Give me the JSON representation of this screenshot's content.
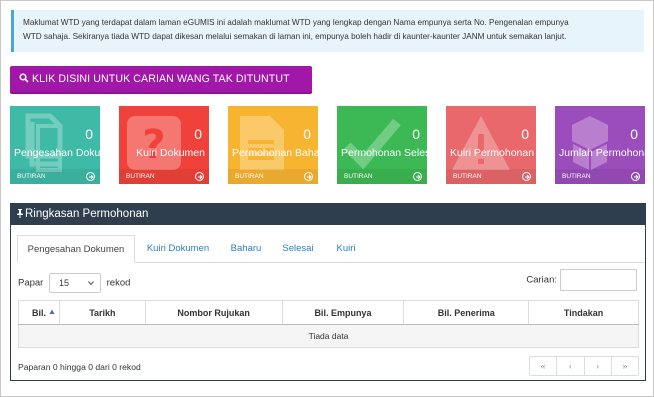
{
  "notice": {
    "line1": "Maklumat WTD yang terdapat dalam laman eGUMIS ini adalah maklumat WTD yang lengkap dengan Nama empunya serta No. Pengenalan empunya",
    "line2": "WTD sahaja. Sekiranya tiada WTD dapat dikesan melalui semakan di laman ini, empunya boleh hadir di kaunter-kaunter JANM untuk semakan lanjut."
  },
  "search_button": {
    "label": "KLIK DISINI UNTUK CARIAN WANG TAK DITUNTUT",
    "icon": "search-icon"
  },
  "tiles": [
    {
      "count": "0",
      "label": "Pengesahan Dokumen",
      "footer": "BUTIRAN",
      "color": "#3fbaa7",
      "icon": "documents-icon"
    },
    {
      "count": "0",
      "label": "Kuiri Dokumen",
      "footer": "BUTIRAN",
      "color": "#f0423a",
      "icon": "question-icon"
    },
    {
      "count": "0",
      "label": "Permohonan Baharu",
      "footer": "BUTIRAN",
      "color": "#f7b431",
      "icon": "document-icon"
    },
    {
      "count": "0",
      "label": "Permohonan Selesai",
      "footer": "BUTIRAN",
      "color": "#3cb954",
      "icon": "check-icon"
    },
    {
      "count": "0",
      "label": "Kuiri Permohonan",
      "footer": "BUTIRAN",
      "color": "#e8686b",
      "icon": "warning-icon"
    },
    {
      "count": "0",
      "label": "Jumlah Permohonan",
      "footer": "BUTIRAN",
      "color": "#9b4dbb",
      "icon": "cubes-icon"
    }
  ],
  "panel": {
    "title": "Ringkasan Permohonan",
    "tabs": [
      "Pengesahan Dokumen",
      "Kuiri Dokumen",
      "Baharu",
      "Selesai",
      "Kuiri"
    ],
    "active_tab": "Pengesahan Dokumen",
    "length": {
      "prefix": "Papar",
      "value": "15",
      "suffix": "rekod"
    },
    "search_label": "Carian:",
    "columns": [
      "Bil.",
      "Tarikh",
      "Nombor Rujukan",
      "Bil. Empunya",
      "Bil. Penerima",
      "Tindakan"
    ],
    "empty_text": "Tiada data",
    "info": "Paparan 0 hingga 0 dari 0 rekod",
    "pager": [
      "«",
      "‹",
      "›",
      "»"
    ]
  }
}
